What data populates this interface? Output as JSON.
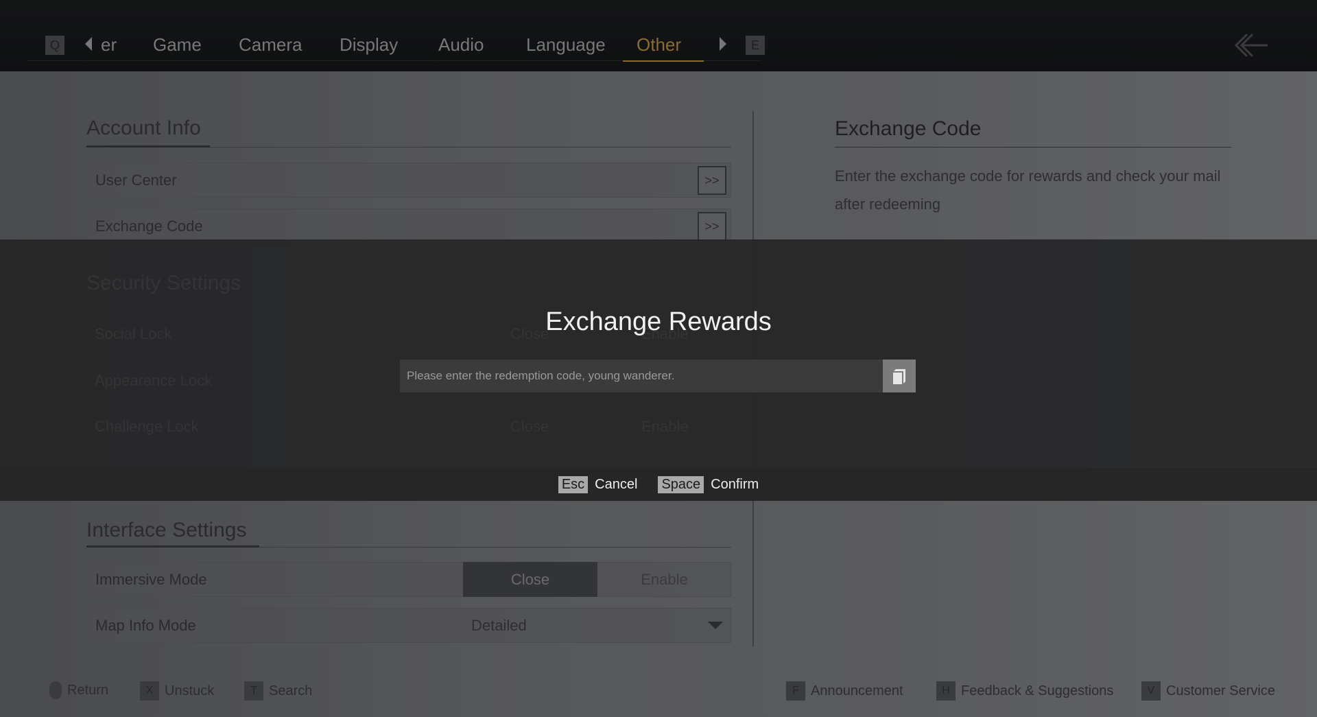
{
  "nav": {
    "left_key": "Q",
    "right_key": "E",
    "tabs": [
      {
        "label": "er"
      },
      {
        "label": "Game"
      },
      {
        "label": "Camera"
      },
      {
        "label": "Display"
      },
      {
        "label": "Audio"
      },
      {
        "label": "Language"
      },
      {
        "label": "Other"
      }
    ],
    "active_tab": "Other",
    "accent": "#8a6a35"
  },
  "account": {
    "title": "Account Info",
    "rows": [
      {
        "label": "User Center"
      },
      {
        "label": "Exchange Code"
      }
    ]
  },
  "security": {
    "title": "Security Settings",
    "rows": [
      {
        "label": "Social Lock",
        "close": "Close",
        "enable": "Enable"
      },
      {
        "label": "Appearance Lock"
      },
      {
        "label": "Challenge Lock",
        "close": "Close",
        "enable": "Enable"
      }
    ]
  },
  "interface": {
    "title": "Interface Settings",
    "immersive": {
      "label": "Immersive Mode",
      "close": "Close",
      "enable": "Enable",
      "selected": "Close"
    },
    "map_info": {
      "label": "Map Info Mode",
      "value": "Detailed"
    }
  },
  "detail": {
    "title": "Exchange Code",
    "description": "Enter the exchange code for rewards and check your mail after redeeming"
  },
  "modal": {
    "title": "Exchange Rewards",
    "placeholder": "Please enter the redemption code, young wanderer.",
    "value": "",
    "cancel_key": "Esc",
    "cancel": "Cancel",
    "confirm_key": "Space",
    "confirm": "Confirm"
  },
  "hints": {
    "left": [
      {
        "key": "",
        "label": "Return"
      },
      {
        "key": "X",
        "label": "Unstuck"
      },
      {
        "key": "T",
        "label": "Search"
      }
    ],
    "right": [
      {
        "key": "F",
        "label": "Announcement"
      },
      {
        "key": "H",
        "label": "Feedback & Suggestions"
      },
      {
        "key": "V",
        "label": "Customer Service"
      }
    ]
  }
}
